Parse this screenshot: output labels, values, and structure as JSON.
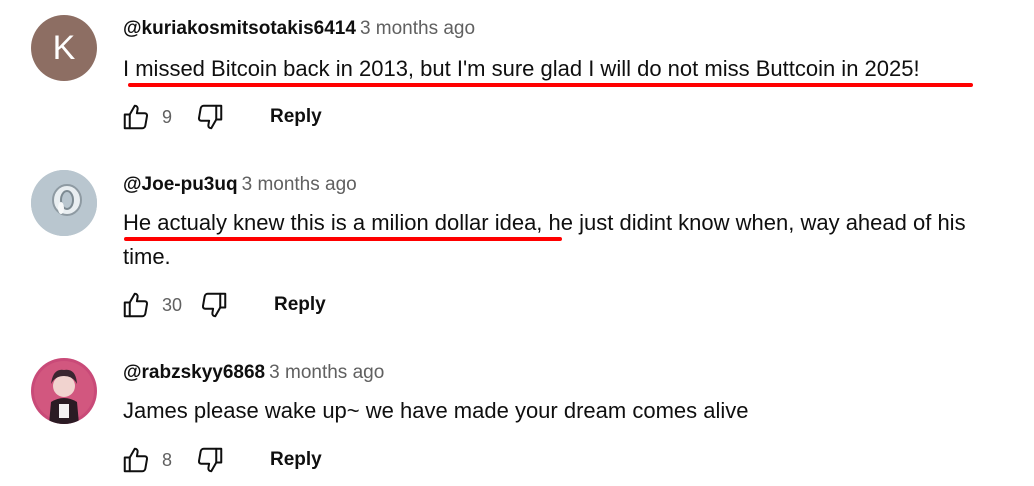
{
  "comments": [
    {
      "avatar_letter": "K",
      "avatar_color": "#8d6e63",
      "handle": "@kuriakosmitsotakis6414",
      "time": "3 months ago",
      "text": "I missed Bitcoin back in 2013, but I'm sure glad I will do not  miss Buttcoin in 2025!",
      "likes": "9",
      "reply_label": "Reply"
    },
    {
      "avatar_icon": "ring-photo-avatar",
      "handle": "@Joe-pu3uq",
      "time": "3 months ago",
      "text": "He actualy knew this is a milion dollar idea, he just didint know when, way ahead of his time.",
      "likes": "30",
      "reply_label": "Reply"
    },
    {
      "avatar_icon": "anime-character-avatar",
      "handle": "@rabzskyy6868",
      "time": "3 months ago",
      "text": "James please wake up~ we have made your dream comes alive",
      "likes": "8",
      "reply_label": "Reply"
    }
  ],
  "annotation_color": "#ff0000"
}
